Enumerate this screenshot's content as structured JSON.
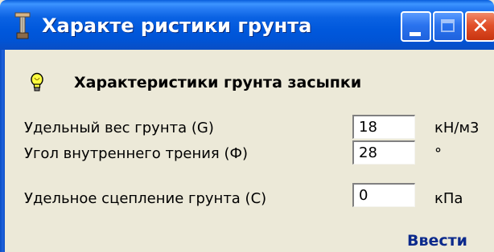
{
  "window": {
    "title": "Характе ристики грунта",
    "icon": "soil-tool-icon",
    "buttons": {
      "minimize_icon": "minimize-icon",
      "maximize_icon": "maximize-icon",
      "close_icon": "close-icon",
      "close_glyph": "✕"
    }
  },
  "section": {
    "icon": "lightbulb-icon",
    "heading": "Характеристики грунта засыпки"
  },
  "params": [
    {
      "label": "Удельный вес грунта (G)",
      "value": "18",
      "unit": "кН/м3"
    },
    {
      "label": "Угол внутреннего трения (Ф)",
      "value": "28",
      "unit": "°"
    },
    {
      "label": "Удельное сцепление грунта (С)",
      "value": "0",
      "unit": "кПа"
    }
  ],
  "actions": {
    "submit_label": "Ввести"
  },
  "colors": {
    "titlebar_accent": "#0054d6",
    "window_background": "#ece9d8",
    "close_button": "#e2502a",
    "submit_link": "#0c2a8c"
  }
}
